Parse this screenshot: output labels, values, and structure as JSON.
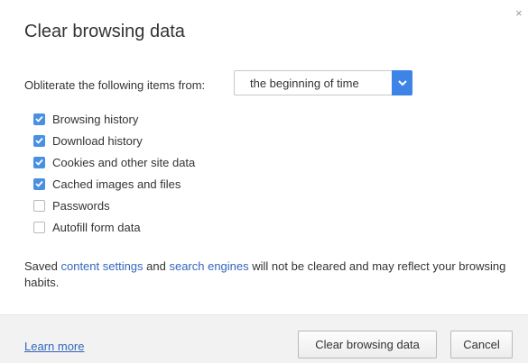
{
  "dialog": {
    "title": "Clear browsing data",
    "close_glyph": "×",
    "range": {
      "label": "Obliterate the following items from:",
      "selected": "the beginning of time"
    },
    "items": [
      {
        "label": "Browsing history",
        "checked": true
      },
      {
        "label": "Download history",
        "checked": true
      },
      {
        "label": "Cookies and other site data",
        "checked": true
      },
      {
        "label": "Cached images and files",
        "checked": true
      },
      {
        "label": "Passwords",
        "checked": false
      },
      {
        "label": "Autofill form data",
        "checked": false
      }
    ],
    "note": {
      "prefix": "Saved ",
      "link1": "content settings",
      "middle": " and ",
      "link2": "search engines",
      "suffix": " will not be cleared and may reflect your browsing habits."
    }
  },
  "footer": {
    "learn_more": "Learn more",
    "clear_button": "Clear browsing data",
    "cancel_button": "Cancel"
  },
  "colors": {
    "accent": "#4a90e2",
    "link": "#3366bb",
    "footer_bg": "#f2f2f2"
  },
  "icons": {
    "close": "close-icon",
    "dropdown": "chevron-down-icon",
    "checked": "checkmark-icon"
  }
}
